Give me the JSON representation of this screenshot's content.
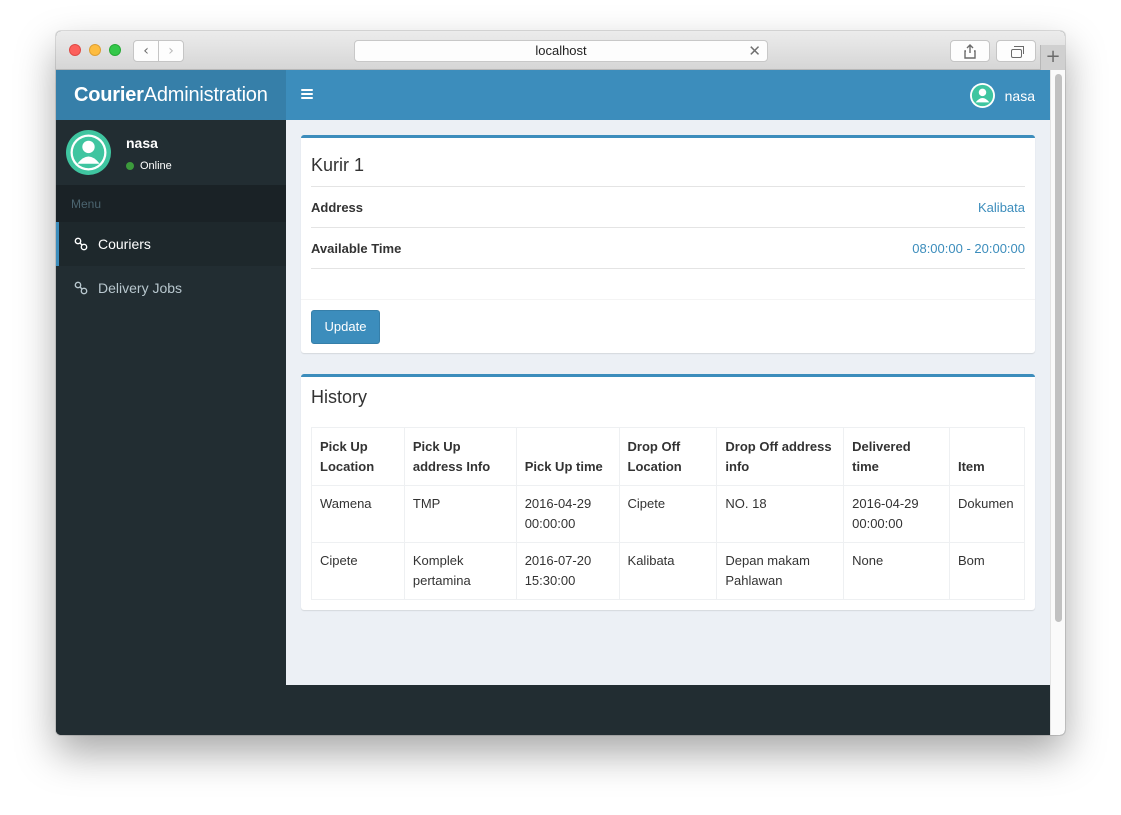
{
  "browser": {
    "url": "localhost"
  },
  "app": {
    "logo_bold": "Courier",
    "logo_light": "Administration",
    "username": "nasa"
  },
  "sidebar": {
    "user_name": "nasa",
    "status": "Online",
    "menu_header": "Menu",
    "items": [
      {
        "label": "Couriers",
        "active": true
      },
      {
        "label": "Delivery Jobs",
        "active": false
      }
    ]
  },
  "courier": {
    "name": "Kurir 1",
    "address_label": "Address",
    "address_value": "Kalibata",
    "time_label": "Available Time",
    "time_value": "08:00:00 - 20:00:00",
    "update_label": "Update"
  },
  "history": {
    "title": "History",
    "columns": [
      [
        "Pick Up",
        "Location"
      ],
      [
        "Pick Up",
        "address Info"
      ],
      [
        "",
        "Pick Up time"
      ],
      [
        "Drop Off",
        "Location"
      ],
      [
        "Drop Off address",
        "info"
      ],
      [
        "Delivered",
        "time"
      ],
      [
        "",
        "Item"
      ]
    ],
    "rows": [
      [
        [
          "Wamena"
        ],
        [
          "TMP"
        ],
        [
          "2016-04-29",
          "00:00:00"
        ],
        [
          "Cipete"
        ],
        [
          "NO. 18"
        ],
        [
          "2016-04-29",
          "00:00:00"
        ],
        [
          "Dokumen"
        ]
      ],
      [
        [
          "Cipete"
        ],
        [
          "Komplek",
          "pertamina"
        ],
        [
          "2016-07-20",
          "15:30:00"
        ],
        [
          "Kalibata"
        ],
        [
          "Depan makam",
          "Pahlawan"
        ],
        [
          "None"
        ],
        [
          "Bom"
        ]
      ]
    ]
  },
  "colors": {
    "primary": "#3c8dbc",
    "primary_dark": "#367fa9",
    "sidebar_bg": "#222d32",
    "avatar": "#3fc5a0",
    "online": "#3c9a3c"
  }
}
